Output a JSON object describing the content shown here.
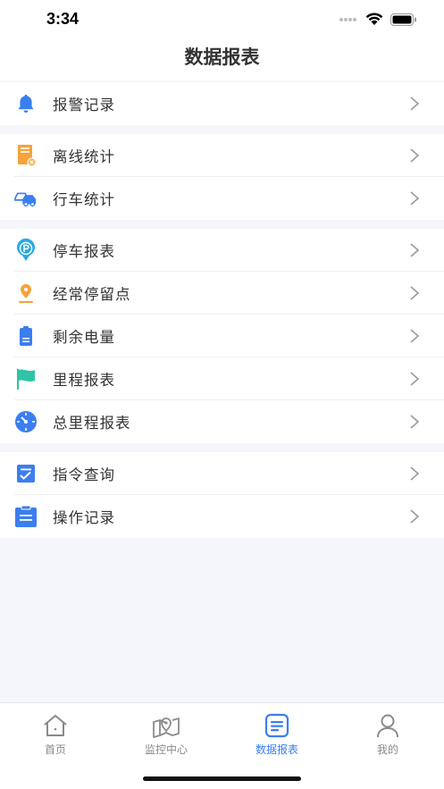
{
  "status_bar": {
    "time": "3:34"
  },
  "header": {
    "title": "数据报表"
  },
  "menu_groups": [
    {
      "items": [
        {
          "label": "报警记录",
          "icon": "bell-icon"
        }
      ]
    },
    {
      "items": [
        {
          "label": "离线统计",
          "icon": "offline-server-icon"
        },
        {
          "label": "行车统计",
          "icon": "driving-cars-icon"
        }
      ]
    },
    {
      "items": [
        {
          "label": "停车报表",
          "icon": "parking-icon"
        },
        {
          "label": "经常停留点",
          "icon": "location-pin-icon"
        },
        {
          "label": "剩余电量",
          "icon": "battery-icon"
        },
        {
          "label": "里程报表",
          "icon": "flag-icon"
        },
        {
          "label": "总里程报表",
          "icon": "speedometer-icon"
        }
      ]
    },
    {
      "items": [
        {
          "label": "指令查询",
          "icon": "command-checklist-icon"
        },
        {
          "label": "操作记录",
          "icon": "clipboard-icon"
        }
      ]
    }
  ],
  "tabbar": {
    "items": [
      {
        "label": "首页",
        "icon": "home-icon",
        "active": false
      },
      {
        "label": "监控中心",
        "icon": "monitor-map-icon",
        "active": false
      },
      {
        "label": "数据报表",
        "icon": "report-icon",
        "active": true
      },
      {
        "label": "我的",
        "icon": "user-icon",
        "active": false
      }
    ]
  },
  "colors": {
    "accent": "#3b7ef0",
    "orange": "#f5a33a",
    "teal": "#2ec4a6",
    "cyan": "#28a8e6"
  }
}
